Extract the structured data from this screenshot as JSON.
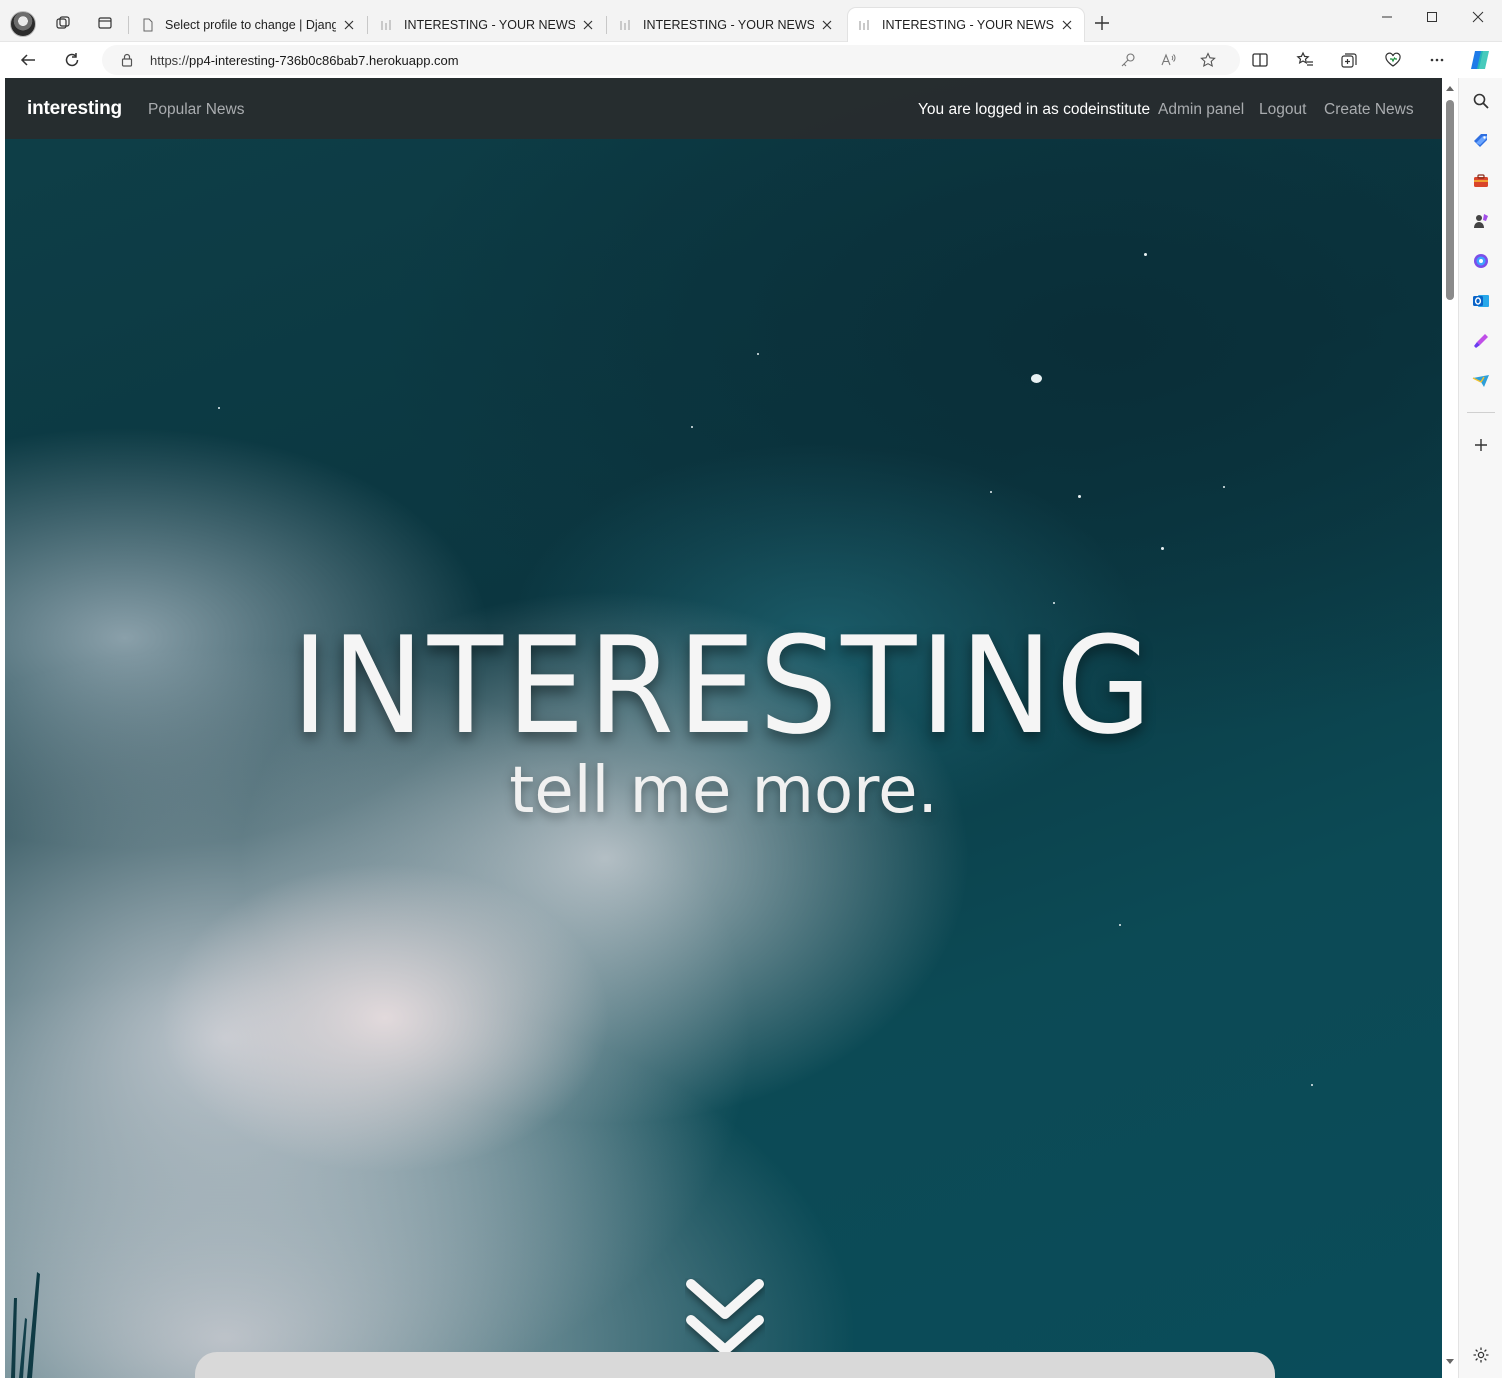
{
  "browser": {
    "tabs": [
      {
        "title": "Select profile to change | Django",
        "active": false
      },
      {
        "title": "INTERESTING - YOUR NEWS FIX",
        "active": false
      },
      {
        "title": "INTERESTING - YOUR NEWS FIX",
        "active": false
      },
      {
        "title": "INTERESTING - YOUR NEWS FIX",
        "active": true
      }
    ],
    "url_scheme": "https://",
    "url_host": "pp4-interesting-736b0c86bab7.herokuapp.com"
  },
  "site": {
    "brand": "interesting",
    "nav_left": [
      "Popular News"
    ],
    "logged_in_text": "You are logged in as codeinstitute",
    "nav_right": [
      "Admin panel",
      "Logout",
      "Create News"
    ]
  },
  "hero": {
    "title": "INTERESTING",
    "subtitle": "tell me more."
  },
  "icons": {
    "sidebar": [
      "search-icon",
      "tag-icon",
      "briefcase-icon",
      "games-icon",
      "office-icon",
      "outlook-icon",
      "designer-icon",
      "telegram-icon",
      "add-icon",
      "settings-icon"
    ],
    "scroll_cue": "chevron-double-down-icon"
  },
  "colors": {
    "navbar": "#2c3032",
    "nav_link": "#a9acaf",
    "hero_dark": "#0d3c45",
    "hero_light": "#c8cdd4"
  }
}
